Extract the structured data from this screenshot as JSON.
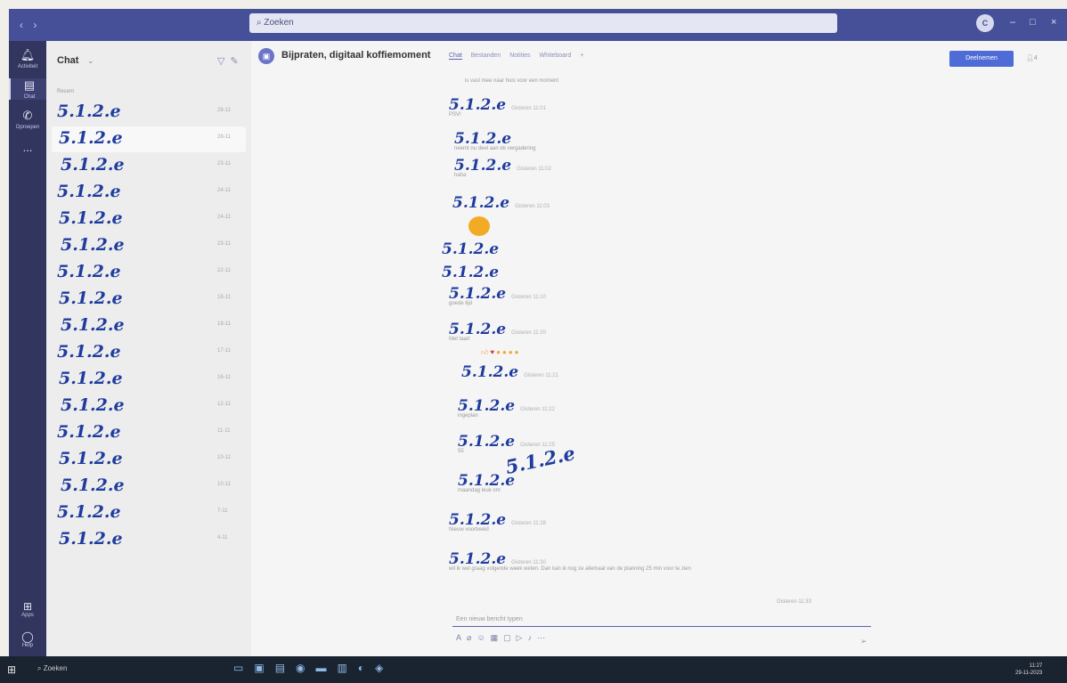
{
  "titlebar": {
    "search_placeholder": "Zoeken",
    "avatar_initials": "C"
  },
  "rail": [
    {
      "icon": "bell-icon",
      "label": "Activiteit"
    },
    {
      "icon": "chat-icon",
      "label": "Chat"
    },
    {
      "icon": "phone-icon",
      "label": "Oproepen"
    },
    {
      "icon": "more-icon",
      "label": "..."
    }
  ],
  "rail_bottom": [
    {
      "icon": "apps-icon",
      "label": "Apps"
    },
    {
      "icon": "help-icon",
      "label": "Help"
    }
  ],
  "chatlist": {
    "title": "Chat",
    "section": "Recent",
    "rows": [
      {
        "name": "5.1.2.e",
        "date": "28-11"
      },
      {
        "name": "5.1.2.e",
        "date": "28-11"
      },
      {
        "name": "5.1.2.e",
        "date": "23-11"
      },
      {
        "name": "5.1.2.e",
        "date": "24-11"
      },
      {
        "name": "5.1.2.e",
        "date": "24-11"
      },
      {
        "name": "5.1.2.e",
        "date": "23-11"
      },
      {
        "name": "5.1.2.e",
        "date": "22-11"
      },
      {
        "name": "5.1.2.e",
        "date": "18-11"
      },
      {
        "name": "5.1.2.e",
        "date": "18-11"
      },
      {
        "name": "5.1.2.e",
        "date": "17-11"
      },
      {
        "name": "5.1.2.e",
        "date": "16-11"
      },
      {
        "name": "5.1.2.e",
        "date": "12-11"
      },
      {
        "name": "5.1.2.e",
        "date": "11-11"
      },
      {
        "name": "5.1.2.e",
        "date": "10-11"
      },
      {
        "name": "5.1.2.e",
        "date": "10-11"
      },
      {
        "name": "5.1.2.e",
        "date": "7-11"
      },
      {
        "name": "5.1.2.e",
        "date": "4-11"
      }
    ]
  },
  "conversation": {
    "title": "Bijpraten, digitaal koffiemoment",
    "tabs": [
      "Chat",
      "Bestanden",
      "Notities",
      "Whiteboard"
    ],
    "join_label": "Deelnemen",
    "header_extra": "4",
    "top_snippet": "is vast mee naar huis voor een moment",
    "messages": [
      {
        "sender": "5.1.2.e",
        "meta": "Gisteren 11:01",
        "body": "PSV!"
      },
      {
        "sender": "5.1.2.e",
        "meta": "",
        "body": "neemt nu deel aan de vergadering"
      },
      {
        "sender": "5.1.2.e",
        "meta": "Gisteren 11:02",
        "body": "haha"
      },
      {
        "sender": "5.1.2.e",
        "meta": "Gisteren 11:03",
        "body": ""
      },
      {
        "sender": "5.1.2.e",
        "meta": "",
        "body": ""
      },
      {
        "sender": "5.1.2.e",
        "meta": "",
        "body": ""
      },
      {
        "sender": "5.1.2.e",
        "meta": "Gisteren 11:10",
        "body": "goede tijd"
      },
      {
        "sender": "5.1.2.e",
        "meta": "Gisteren 11:20",
        "body": "Met taart"
      },
      {
        "sender": "5.1.2.e",
        "meta": "Gisteren 11:21",
        "body": ""
      },
      {
        "sender": "5.1.2.e",
        "meta": "Gisteren 11:22",
        "body": "ingeplan"
      },
      {
        "sender": "5.1.2.e",
        "meta": "Gisteren 11:25",
        "body": "55"
      },
      {
        "sender": "5.1.2.e",
        "meta": "",
        "body": "maandag leuk om"
      },
      {
        "sender": "5.1.2.e",
        "meta": "Gisteren 11:28",
        "body": "Nieuw voorbeeld"
      },
      {
        "sender": "5.1.2.e",
        "meta": "Gisteren 11:30",
        "body": "wil ik wel graag volgende week weten. Dan kan ik nog ze allemaal van de planning 25 min voor te zien"
      }
    ],
    "big_scribble": "5.1.2.e",
    "last_seen": "Gisteren 11:33",
    "compose_placeholder": "Een nieuw bericht typen"
  },
  "taskbar": {
    "search_label": "Zoeken",
    "time": "11:27",
    "date": "29-11-2023"
  }
}
